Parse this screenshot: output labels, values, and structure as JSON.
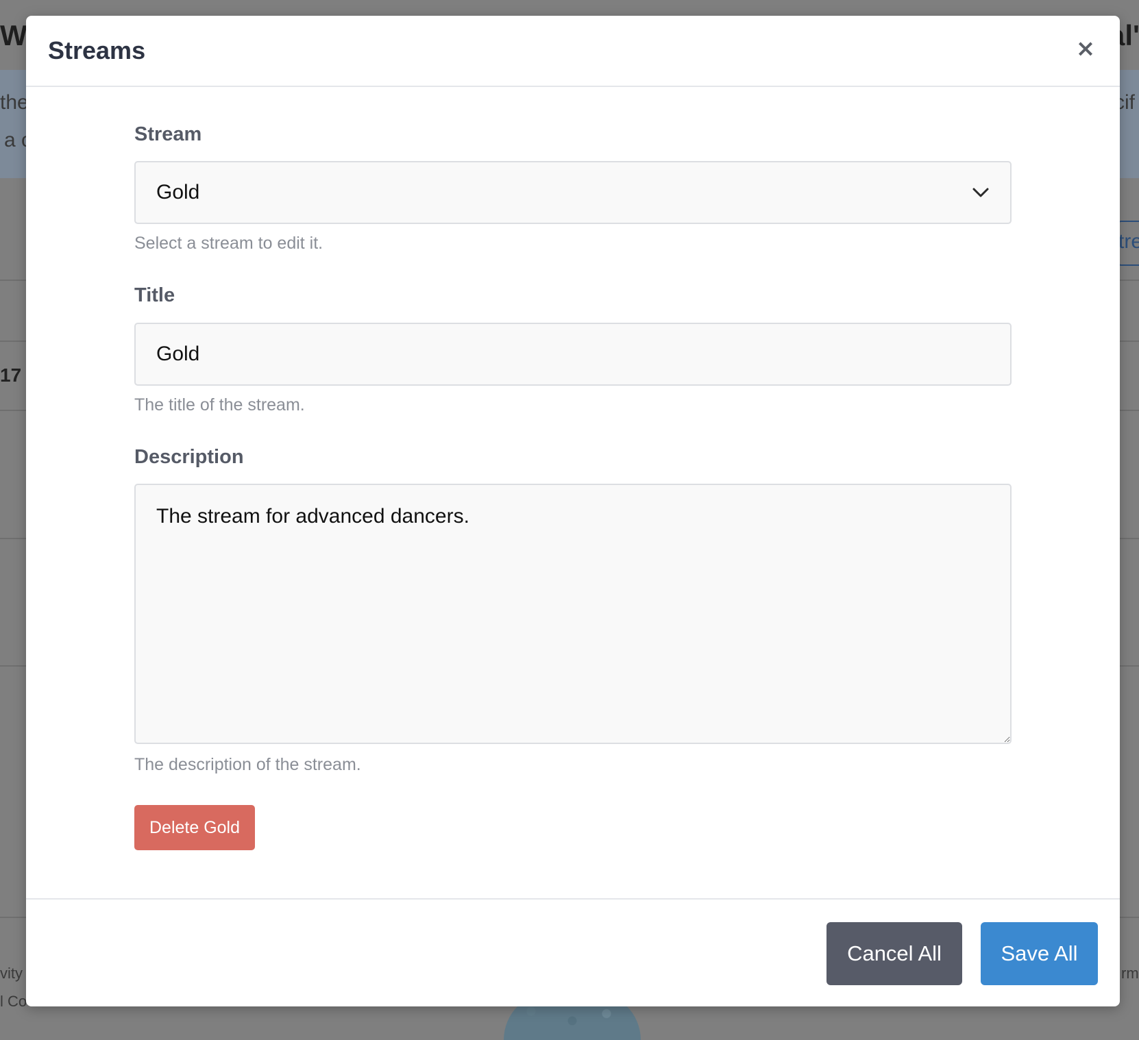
{
  "background": {
    "fragments": [
      "Wh",
      "al'",
      "the",
      "a c",
      "cif",
      "tre",
      "17",
      "vity",
      "l Co",
      "rm"
    ]
  },
  "modal": {
    "title": "Streams",
    "close_label": "×",
    "stream": {
      "label": "Stream",
      "selected": "Gold",
      "help": "Select a stream to edit it."
    },
    "title_field": {
      "label": "Title",
      "value": "Gold",
      "help": "The title of the stream."
    },
    "description": {
      "label": "Description",
      "value": "The stream for advanced dancers.",
      "help": "The description of the stream."
    },
    "delete_label": "Delete Gold",
    "cancel_label": "Cancel All",
    "save_label": "Save All"
  },
  "colors": {
    "overlay": "#7f7f7f",
    "danger": "#d86a5f",
    "secondary": "#575b68",
    "primary": "#3b89d0"
  },
  "icons": {
    "close": "close-icon",
    "select": "chevron-down-icon"
  }
}
